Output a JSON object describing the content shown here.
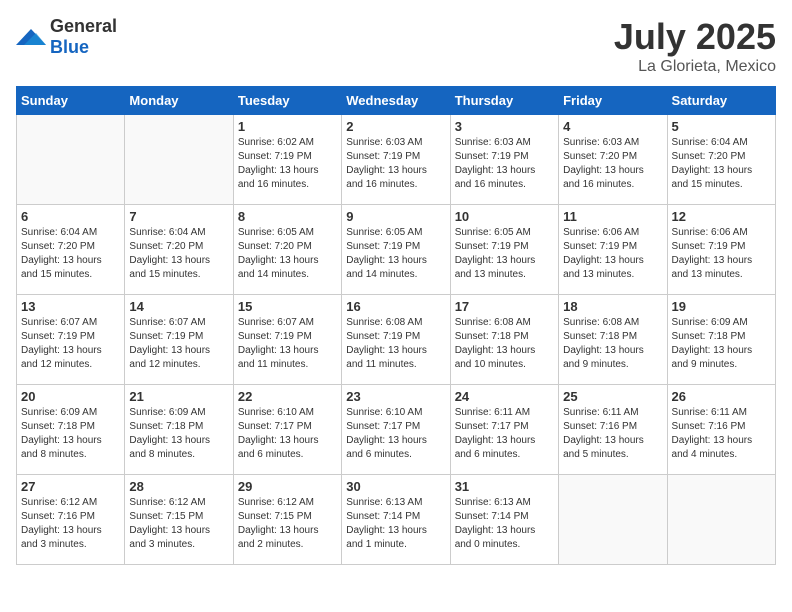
{
  "header": {
    "logo_general": "General",
    "logo_blue": "Blue",
    "title": "July 2025",
    "subtitle": "La Glorieta, Mexico"
  },
  "weekdays": [
    "Sunday",
    "Monday",
    "Tuesday",
    "Wednesday",
    "Thursday",
    "Friday",
    "Saturday"
  ],
  "weeks": [
    [
      {
        "day": "",
        "info": ""
      },
      {
        "day": "",
        "info": ""
      },
      {
        "day": "1",
        "info": "Sunrise: 6:02 AM\nSunset: 7:19 PM\nDaylight: 13 hours and 16 minutes."
      },
      {
        "day": "2",
        "info": "Sunrise: 6:03 AM\nSunset: 7:19 PM\nDaylight: 13 hours and 16 minutes."
      },
      {
        "day": "3",
        "info": "Sunrise: 6:03 AM\nSunset: 7:19 PM\nDaylight: 13 hours and 16 minutes."
      },
      {
        "day": "4",
        "info": "Sunrise: 6:03 AM\nSunset: 7:20 PM\nDaylight: 13 hours and 16 minutes."
      },
      {
        "day": "5",
        "info": "Sunrise: 6:04 AM\nSunset: 7:20 PM\nDaylight: 13 hours and 15 minutes."
      }
    ],
    [
      {
        "day": "6",
        "info": "Sunrise: 6:04 AM\nSunset: 7:20 PM\nDaylight: 13 hours and 15 minutes."
      },
      {
        "day": "7",
        "info": "Sunrise: 6:04 AM\nSunset: 7:20 PM\nDaylight: 13 hours and 15 minutes."
      },
      {
        "day": "8",
        "info": "Sunrise: 6:05 AM\nSunset: 7:20 PM\nDaylight: 13 hours and 14 minutes."
      },
      {
        "day": "9",
        "info": "Sunrise: 6:05 AM\nSunset: 7:19 PM\nDaylight: 13 hours and 14 minutes."
      },
      {
        "day": "10",
        "info": "Sunrise: 6:05 AM\nSunset: 7:19 PM\nDaylight: 13 hours and 13 minutes."
      },
      {
        "day": "11",
        "info": "Sunrise: 6:06 AM\nSunset: 7:19 PM\nDaylight: 13 hours and 13 minutes."
      },
      {
        "day": "12",
        "info": "Sunrise: 6:06 AM\nSunset: 7:19 PM\nDaylight: 13 hours and 13 minutes."
      }
    ],
    [
      {
        "day": "13",
        "info": "Sunrise: 6:07 AM\nSunset: 7:19 PM\nDaylight: 13 hours and 12 minutes."
      },
      {
        "day": "14",
        "info": "Sunrise: 6:07 AM\nSunset: 7:19 PM\nDaylight: 13 hours and 12 minutes."
      },
      {
        "day": "15",
        "info": "Sunrise: 6:07 AM\nSunset: 7:19 PM\nDaylight: 13 hours and 11 minutes."
      },
      {
        "day": "16",
        "info": "Sunrise: 6:08 AM\nSunset: 7:19 PM\nDaylight: 13 hours and 11 minutes."
      },
      {
        "day": "17",
        "info": "Sunrise: 6:08 AM\nSunset: 7:18 PM\nDaylight: 13 hours and 10 minutes."
      },
      {
        "day": "18",
        "info": "Sunrise: 6:08 AM\nSunset: 7:18 PM\nDaylight: 13 hours and 9 minutes."
      },
      {
        "day": "19",
        "info": "Sunrise: 6:09 AM\nSunset: 7:18 PM\nDaylight: 13 hours and 9 minutes."
      }
    ],
    [
      {
        "day": "20",
        "info": "Sunrise: 6:09 AM\nSunset: 7:18 PM\nDaylight: 13 hours and 8 minutes."
      },
      {
        "day": "21",
        "info": "Sunrise: 6:09 AM\nSunset: 7:18 PM\nDaylight: 13 hours and 8 minutes."
      },
      {
        "day": "22",
        "info": "Sunrise: 6:10 AM\nSunset: 7:17 PM\nDaylight: 13 hours and 6 minutes."
      },
      {
        "day": "23",
        "info": "Sunrise: 6:10 AM\nSunset: 7:17 PM\nDaylight: 13 hours and 6 minutes."
      },
      {
        "day": "24",
        "info": "Sunrise: 6:11 AM\nSunset: 7:17 PM\nDaylight: 13 hours and 6 minutes."
      },
      {
        "day": "25",
        "info": "Sunrise: 6:11 AM\nSunset: 7:16 PM\nDaylight: 13 hours and 5 minutes."
      },
      {
        "day": "26",
        "info": "Sunrise: 6:11 AM\nSunset: 7:16 PM\nDaylight: 13 hours and 4 minutes."
      }
    ],
    [
      {
        "day": "27",
        "info": "Sunrise: 6:12 AM\nSunset: 7:16 PM\nDaylight: 13 hours and 3 minutes."
      },
      {
        "day": "28",
        "info": "Sunrise: 6:12 AM\nSunset: 7:15 PM\nDaylight: 13 hours and 3 minutes."
      },
      {
        "day": "29",
        "info": "Sunrise: 6:12 AM\nSunset: 7:15 PM\nDaylight: 13 hours and 2 minutes."
      },
      {
        "day": "30",
        "info": "Sunrise: 6:13 AM\nSunset: 7:14 PM\nDaylight: 13 hours and 1 minute."
      },
      {
        "day": "31",
        "info": "Sunrise: 6:13 AM\nSunset: 7:14 PM\nDaylight: 13 hours and 0 minutes."
      },
      {
        "day": "",
        "info": ""
      },
      {
        "day": "",
        "info": ""
      }
    ]
  ]
}
